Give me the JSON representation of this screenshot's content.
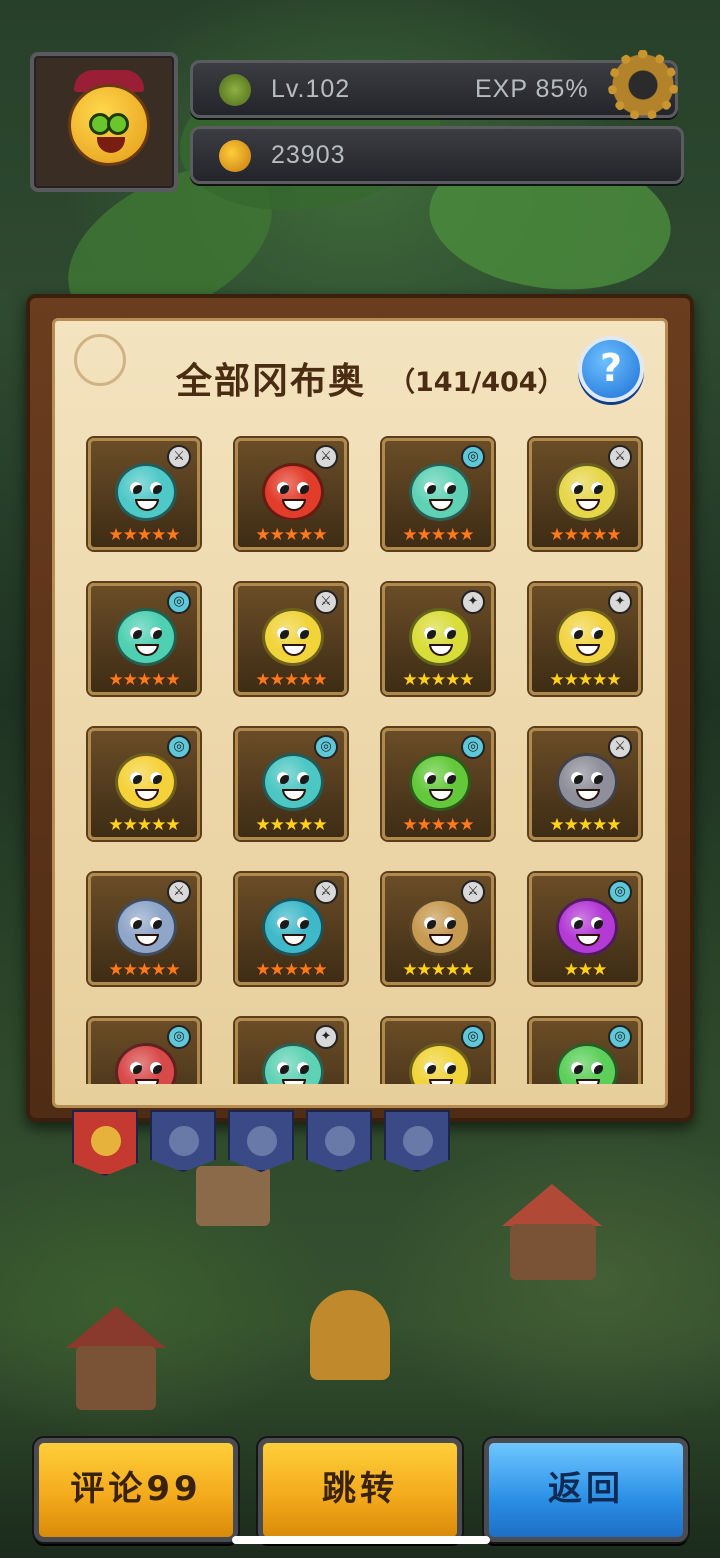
{
  "hud": {
    "level": "Lv.102",
    "exp": "EXP 85%",
    "currency": "23903"
  },
  "panel": {
    "title": "全部冈布奥",
    "count": "（141/404）",
    "help_label": "?"
  },
  "cards": [
    {
      "color": "#4fc9c8",
      "element": "sword",
      "stars": "★★★★★",
      "star_color": "orange"
    },
    {
      "color": "#e23c2a",
      "element": "sword",
      "stars": "★★★★★",
      "star_color": "orange"
    },
    {
      "color": "#5fd2b5",
      "element": "swirl",
      "stars": "★★★★★",
      "star_color": "orange"
    },
    {
      "color": "#e6d64a",
      "element": "sword",
      "stars": "★★★★★",
      "star_color": "orange"
    },
    {
      "color": "#4fd0b2",
      "element": "swirl",
      "stars": "★★★★★",
      "star_color": "orange"
    },
    {
      "color": "#f0d43a",
      "element": "sword",
      "stars": "★★★★★",
      "star_color": "orange"
    },
    {
      "color": "#d9dd3a",
      "element": "wand",
      "stars": "★★★★★",
      "star_color": "gold"
    },
    {
      "color": "#f2d442",
      "element": "wand",
      "stars": "★★★★★",
      "star_color": "gold"
    },
    {
      "color": "#f5d23a",
      "element": "swirl",
      "stars": "★★★★★",
      "star_color": "gold"
    },
    {
      "color": "#4cc7c3",
      "element": "swirl",
      "stars": "★★★★★",
      "star_color": "gold"
    },
    {
      "color": "#63c93a",
      "element": "swirl",
      "stars": "★★★★★",
      "star_color": "orange"
    },
    {
      "color": "#8e8f9a",
      "element": "sword",
      "stars": "★★★★★",
      "star_color": "gold"
    },
    {
      "color": "#8fa6c9",
      "element": "sword",
      "stars": "★★★★★",
      "star_color": "orange"
    },
    {
      "color": "#3fb8c9",
      "element": "sword",
      "stars": "★★★★★",
      "star_color": "orange"
    },
    {
      "color": "#c79a52",
      "element": "sword",
      "stars": "★★★★★",
      "star_color": "gold"
    },
    {
      "color": "#b43ad6",
      "element": "swirl",
      "stars": "★★★",
      "star_color": "gold"
    },
    {
      "color": "#d84a4a",
      "element": "swirl",
      "stars": "",
      "star_color": "orange"
    },
    {
      "color": "#5fd2b5",
      "element": "wand",
      "stars": "",
      "star_color": "gold"
    },
    {
      "color": "#f0d43a",
      "element": "swirl",
      "stars": "",
      "star_color": "gold"
    },
    {
      "color": "#5ccf5a",
      "element": "swirl",
      "stars": "",
      "star_color": "gold"
    }
  ],
  "tabs": [
    "all",
    "blue",
    "green",
    "gold",
    "red"
  ],
  "buttons": {
    "comment": "评论99",
    "jump": "跳转",
    "back": "返回"
  }
}
